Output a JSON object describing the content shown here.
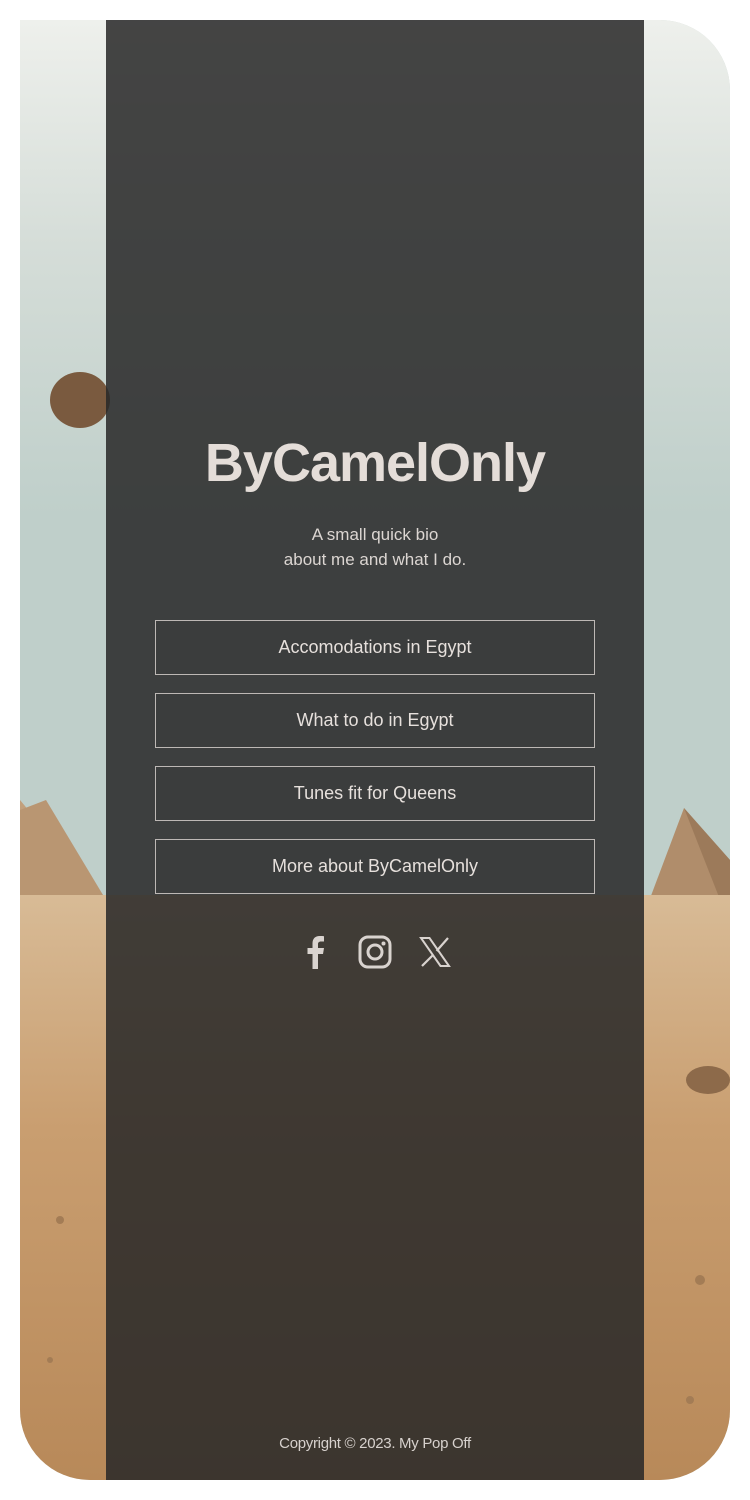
{
  "profile": {
    "name": "ByCamelOnly",
    "bio_line1": "A small quick bio",
    "bio_line2": "about me and what I do."
  },
  "links": [
    {
      "label": "Accomodations in Egypt"
    },
    {
      "label": "What to do in Egypt"
    },
    {
      "label": "Tunes fit for Queens"
    },
    {
      "label": "More about ByCamelOnly"
    }
  ],
  "socials": [
    {
      "icon": "facebook-icon"
    },
    {
      "icon": "instagram-icon"
    },
    {
      "icon": "x-icon"
    }
  ],
  "footer": {
    "copyright": "Copyright © 2023. My Pop Off"
  },
  "colors": {
    "panel": "#282828",
    "text": "#e4ddd8",
    "sky": "#c9d6d2",
    "sand": "#c9a57c"
  }
}
